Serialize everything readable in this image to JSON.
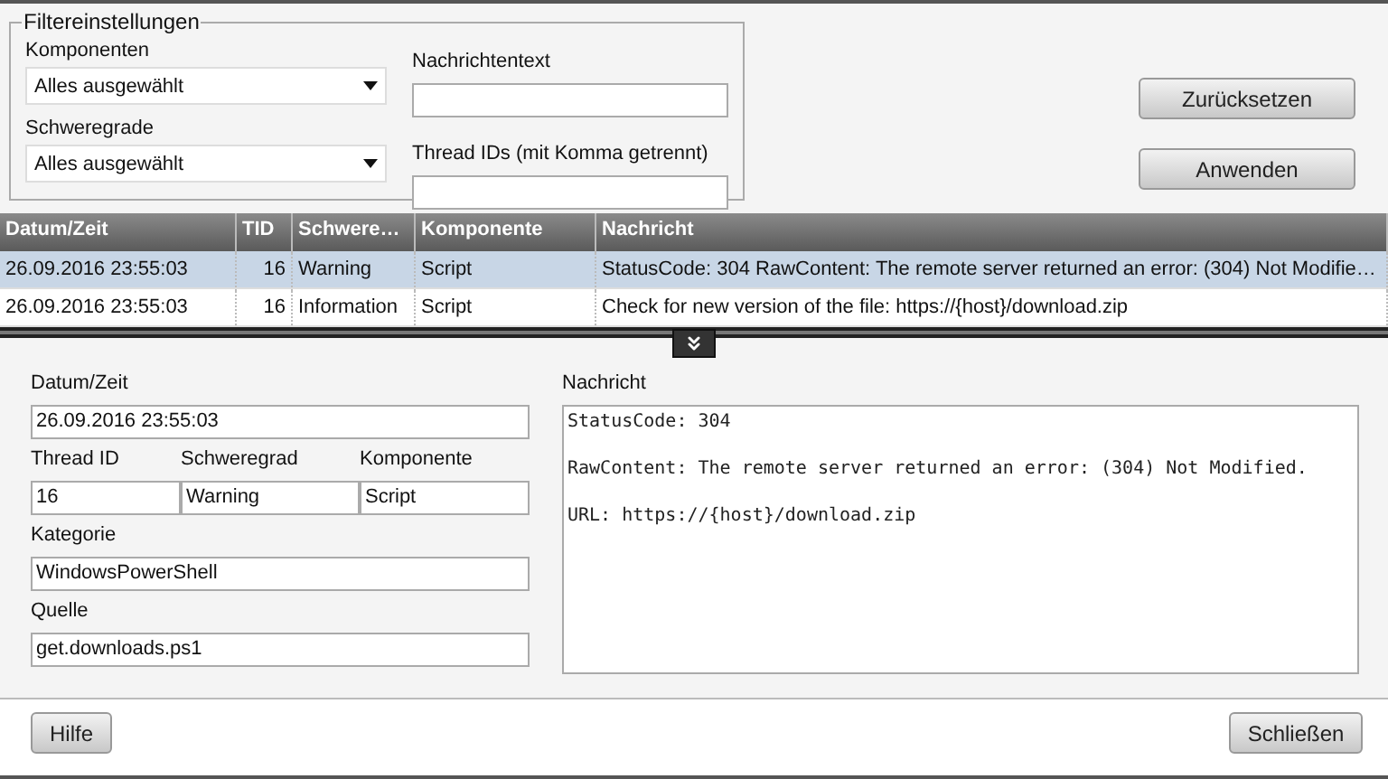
{
  "filter": {
    "legend": "Filtereinstellungen",
    "dropdowns": [
      {
        "label": "Komponenten",
        "value": "Alles ausgewählt"
      },
      {
        "label": "Schweregrade",
        "value": "Alles ausgewählt"
      }
    ],
    "text_fields": [
      {
        "label": "Nachrichtentext"
      },
      {
        "label": "Thread IDs (mit Komma getrennt)"
      }
    ],
    "buttons": [
      "Zurücksetzen",
      "Anwenden"
    ]
  },
  "table": {
    "columns": [
      "Datum/Zeit",
      "TID",
      "Schwere…",
      "Komponente",
      "Nachricht"
    ],
    "rows": [
      {
        "selected": true,
        "cells": [
          "26.09.2016 23:55:03",
          "16",
          "Warning",
          "Script",
          "StatusCode: 304 RawContent: The remote server returned an error: (304) Not Modifie…"
        ]
      },
      {
        "selected": false,
        "cells": [
          "26.09.2016 23:55:03",
          "16",
          "Information",
          "Script",
          "Check for new version of the file: https://{host}/download.zip"
        ]
      }
    ]
  },
  "details": {
    "datetime": {
      "label": "Datum/Zeit",
      "value": "26.09.2016 23:55:03"
    },
    "row": [
      {
        "label": "Thread ID",
        "value": "16"
      },
      {
        "label": "Schweregrad",
        "value": "Warning"
      },
      {
        "label": "Komponente",
        "value": "Script"
      }
    ],
    "category": {
      "label": "Kategorie",
      "value": "WindowsPowerShell"
    },
    "source": {
      "label": "Quelle",
      "value": "get.downloads.ps1"
    },
    "message": {
      "label": "Nachricht",
      "lines": [
        "StatusCode: 304",
        "RawContent: The remote server returned an error: (304) Not Modified.",
        "URL: https://{host}/download.zip"
      ]
    }
  },
  "splitter": {
    "expanded": true
  },
  "footer": {
    "help": "Hilfe",
    "close": "Schließen"
  }
}
